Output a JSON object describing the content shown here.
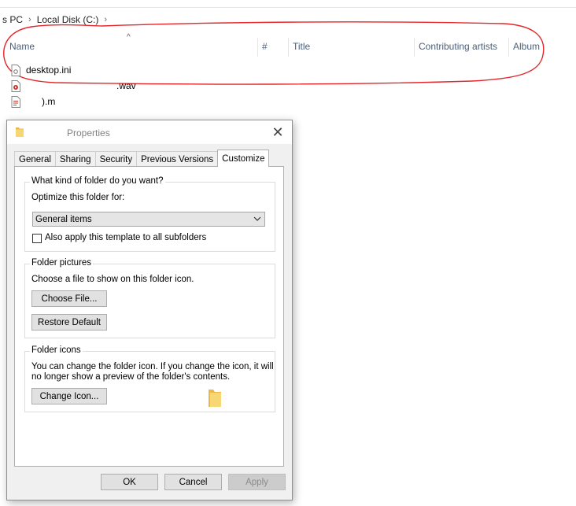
{
  "breadcrumb": [
    "s PC",
    "Local Disk (C:)"
  ],
  "columns": {
    "name": "Name",
    "number": "#",
    "title": "Title",
    "contributing_artists": "Contributing artists",
    "album": "Album",
    "sort_indicator": "^"
  },
  "files": [
    {
      "name": "desktop.ini",
      "icon": "settings-file-icon"
    },
    {
      "name": ".wav",
      "icon": "audio-file-icon"
    },
    {
      "name": ").m",
      "icon": "playlist-file-icon"
    }
  ],
  "dialog": {
    "title": "Properties",
    "tabs": [
      "General",
      "Sharing",
      "Security",
      "Previous Versions",
      "Customize"
    ],
    "active_tab": "Customize",
    "folder_type": {
      "legend": "What kind of folder do you want?",
      "optimize_label": "Optimize this folder for:",
      "selected_option": "General items",
      "apply_subfolders_label": "Also apply this template to all subfolders",
      "apply_subfolders_checked": false
    },
    "folder_pictures": {
      "legend": "Folder pictures",
      "description": "Choose a file to show on this folder icon.",
      "choose_file_button": "Choose File...",
      "restore_default_button": "Restore Default"
    },
    "folder_icons": {
      "legend": "Folder icons",
      "description_line1": "You can change the folder icon. If you change the icon, it will",
      "description_line2": "no longer show a preview of the folder's contents.",
      "change_icon_button": "Change Icon..."
    },
    "buttons": {
      "ok": "OK",
      "cancel": "Cancel",
      "apply": "Apply"
    }
  },
  "colors": {
    "annotation": "#e3262b",
    "header_text": "#4c607a",
    "folder_yellow": "#f7d774"
  }
}
